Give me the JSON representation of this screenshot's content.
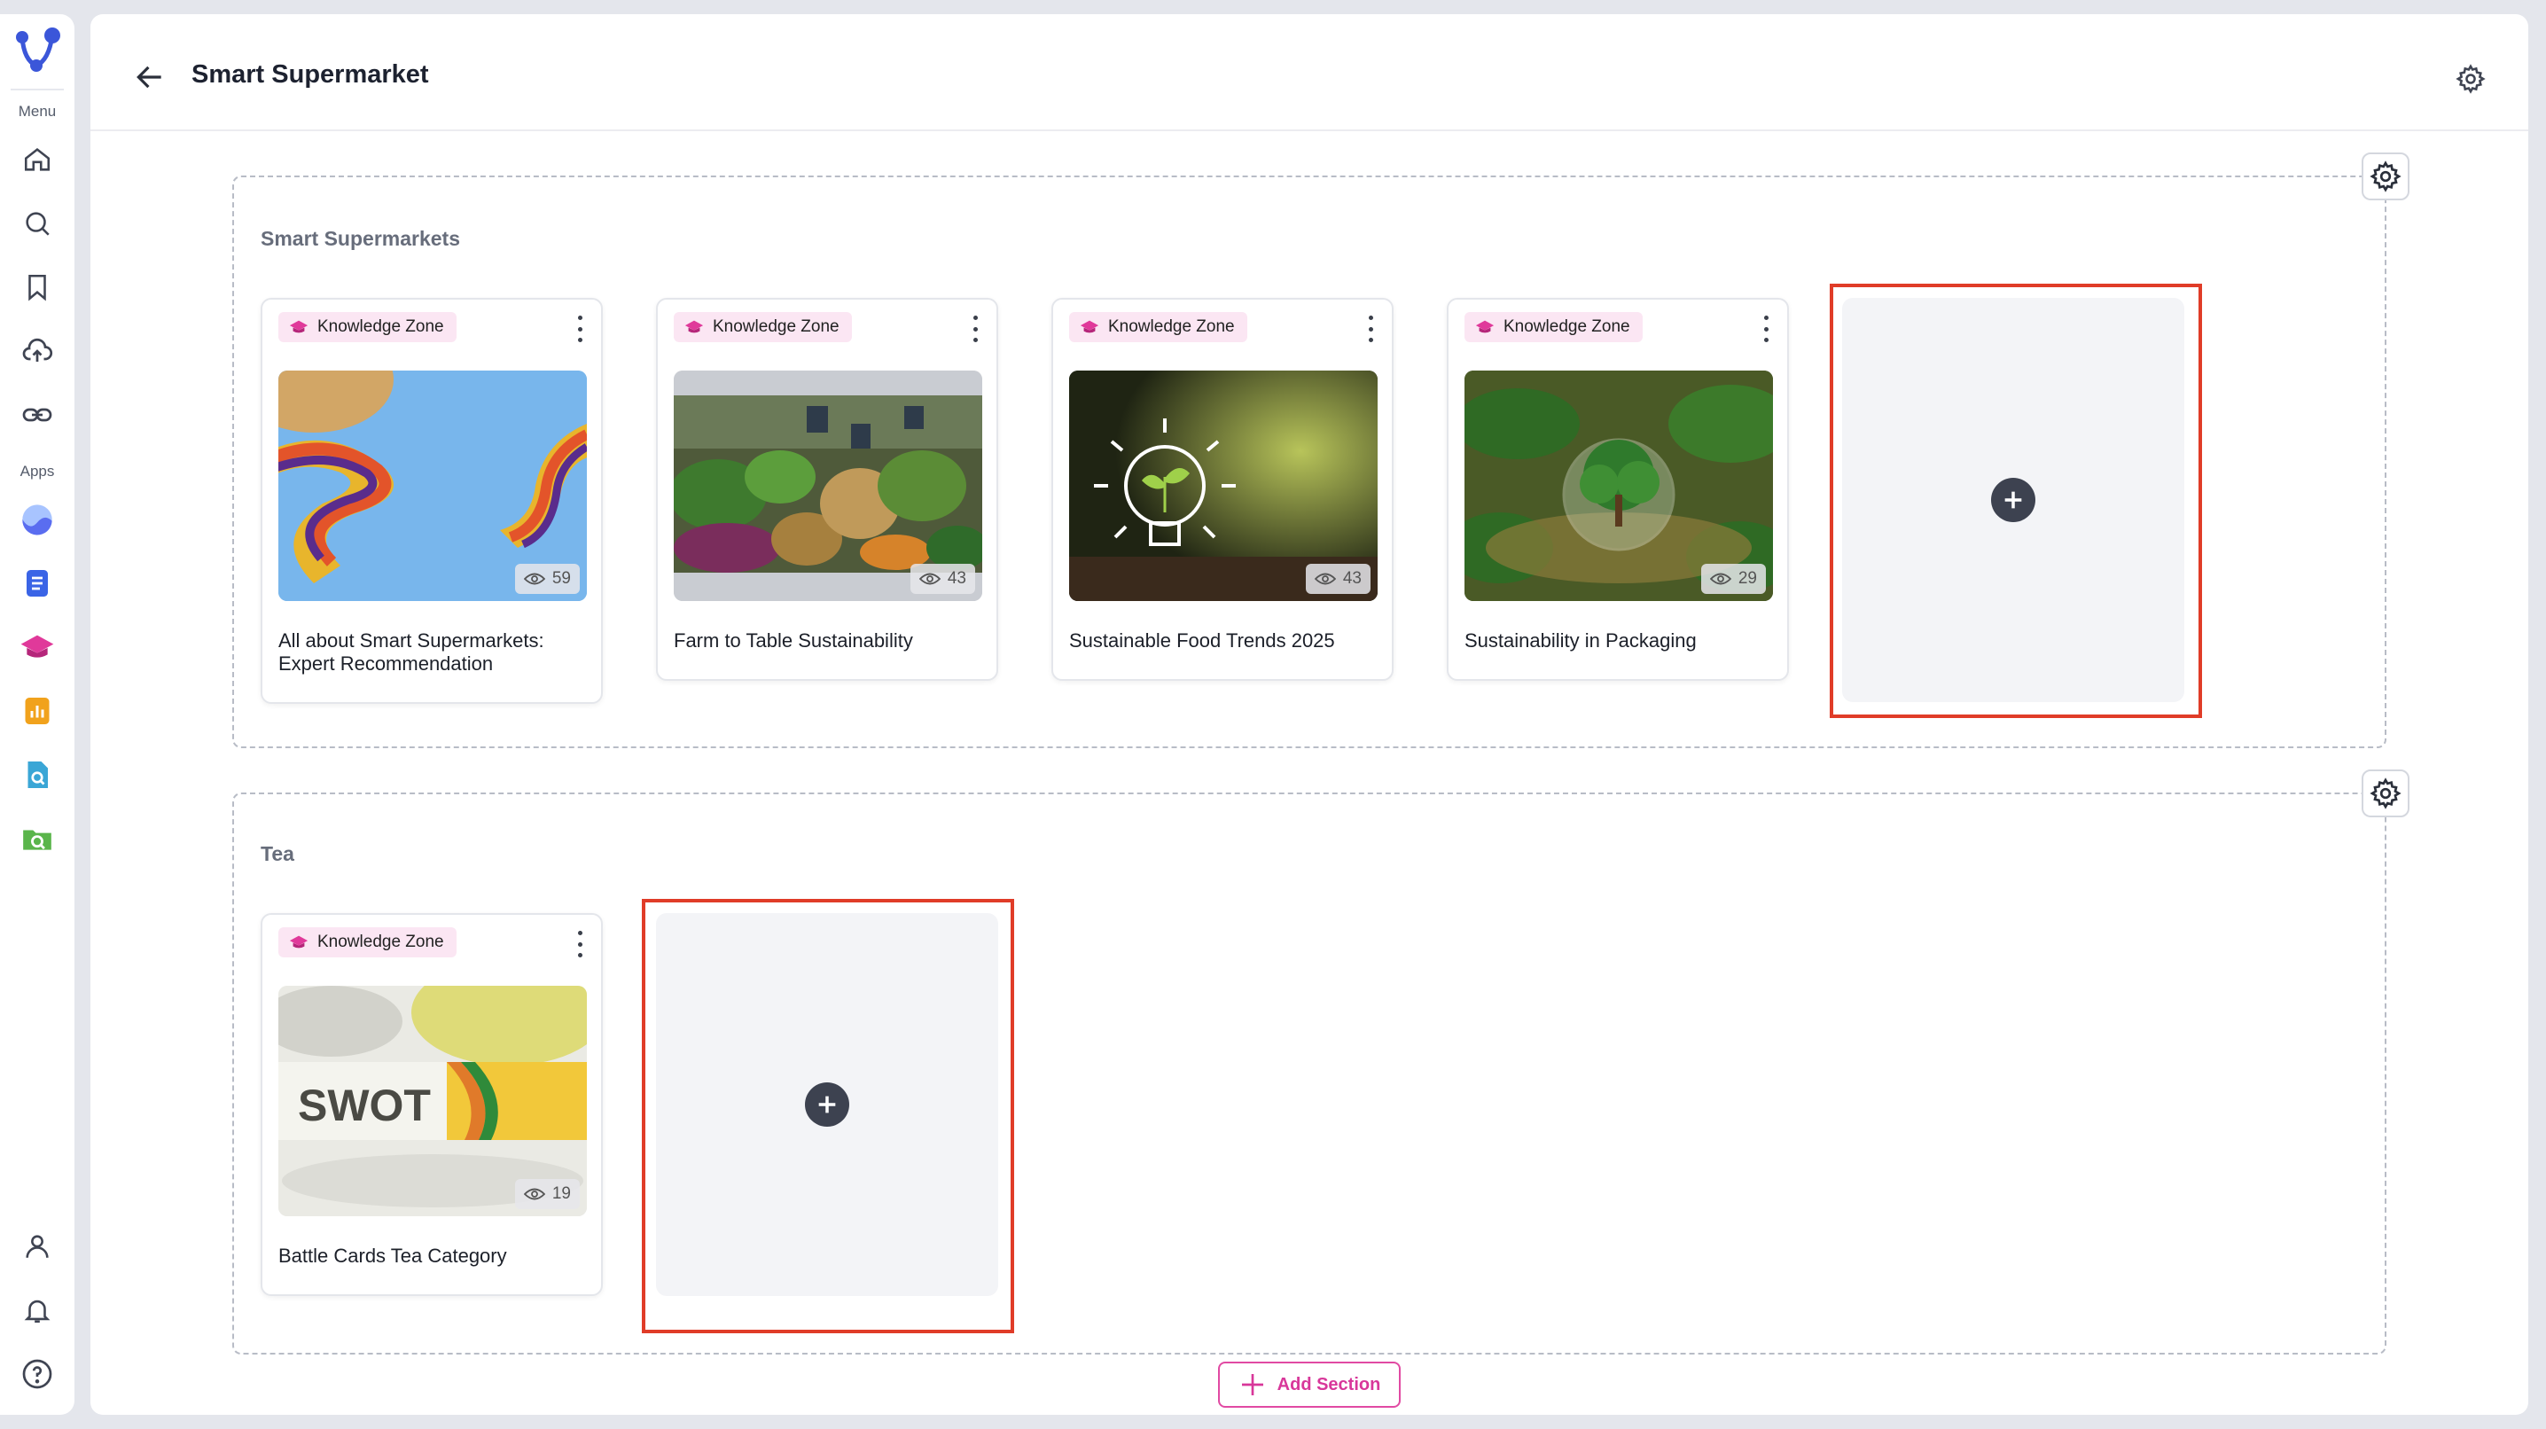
{
  "sidebar": {
    "menu_label": "Menu",
    "apps_label": "Apps",
    "menu_items": [
      "home-icon",
      "search-icon",
      "bookmark-icon",
      "upload-cloud-icon",
      "link-icon"
    ],
    "app_items": [
      "wave-app-icon",
      "document-app-icon",
      "knowledge-zone-app-icon",
      "chart-app-icon",
      "doc-search-app-icon",
      "folder-search-app-icon"
    ],
    "bottom_items": [
      "user-icon",
      "bell-icon",
      "help-icon"
    ]
  },
  "header": {
    "title": "Smart Supermarket"
  },
  "sections": [
    {
      "title": "Smart Supermarkets",
      "cards": [
        {
          "badge": "Knowledge Zone",
          "views": "59",
          "title": "All about Smart Supermarkets: Expert Recommendation",
          "thumb": "abstract-waves"
        },
        {
          "badge": "Knowledge Zone",
          "views": "43",
          "title": "Farm to Table Sustainability",
          "thumb": "vegetable-market"
        },
        {
          "badge": "Knowledge Zone",
          "views": "43",
          "title": "Sustainable Food Trends 2025",
          "thumb": "lightbulb-plant"
        },
        {
          "badge": "Knowledge Zone",
          "views": "29",
          "title": "Sustainability in Packaging",
          "thumb": "glass-sphere-tree"
        }
      ]
    },
    {
      "title": "Tea",
      "cards": [
        {
          "badge": "Knowledge Zone",
          "views": "19",
          "title": "Battle Cards Tea Category",
          "thumb": "swot-slide",
          "thumb_text": "SWOT"
        }
      ]
    }
  ],
  "add_section_label": "Add Section",
  "colors": {
    "accent": "#d8379a",
    "highlight": "#e03c28",
    "badge_bg": "#fbe6f3"
  }
}
